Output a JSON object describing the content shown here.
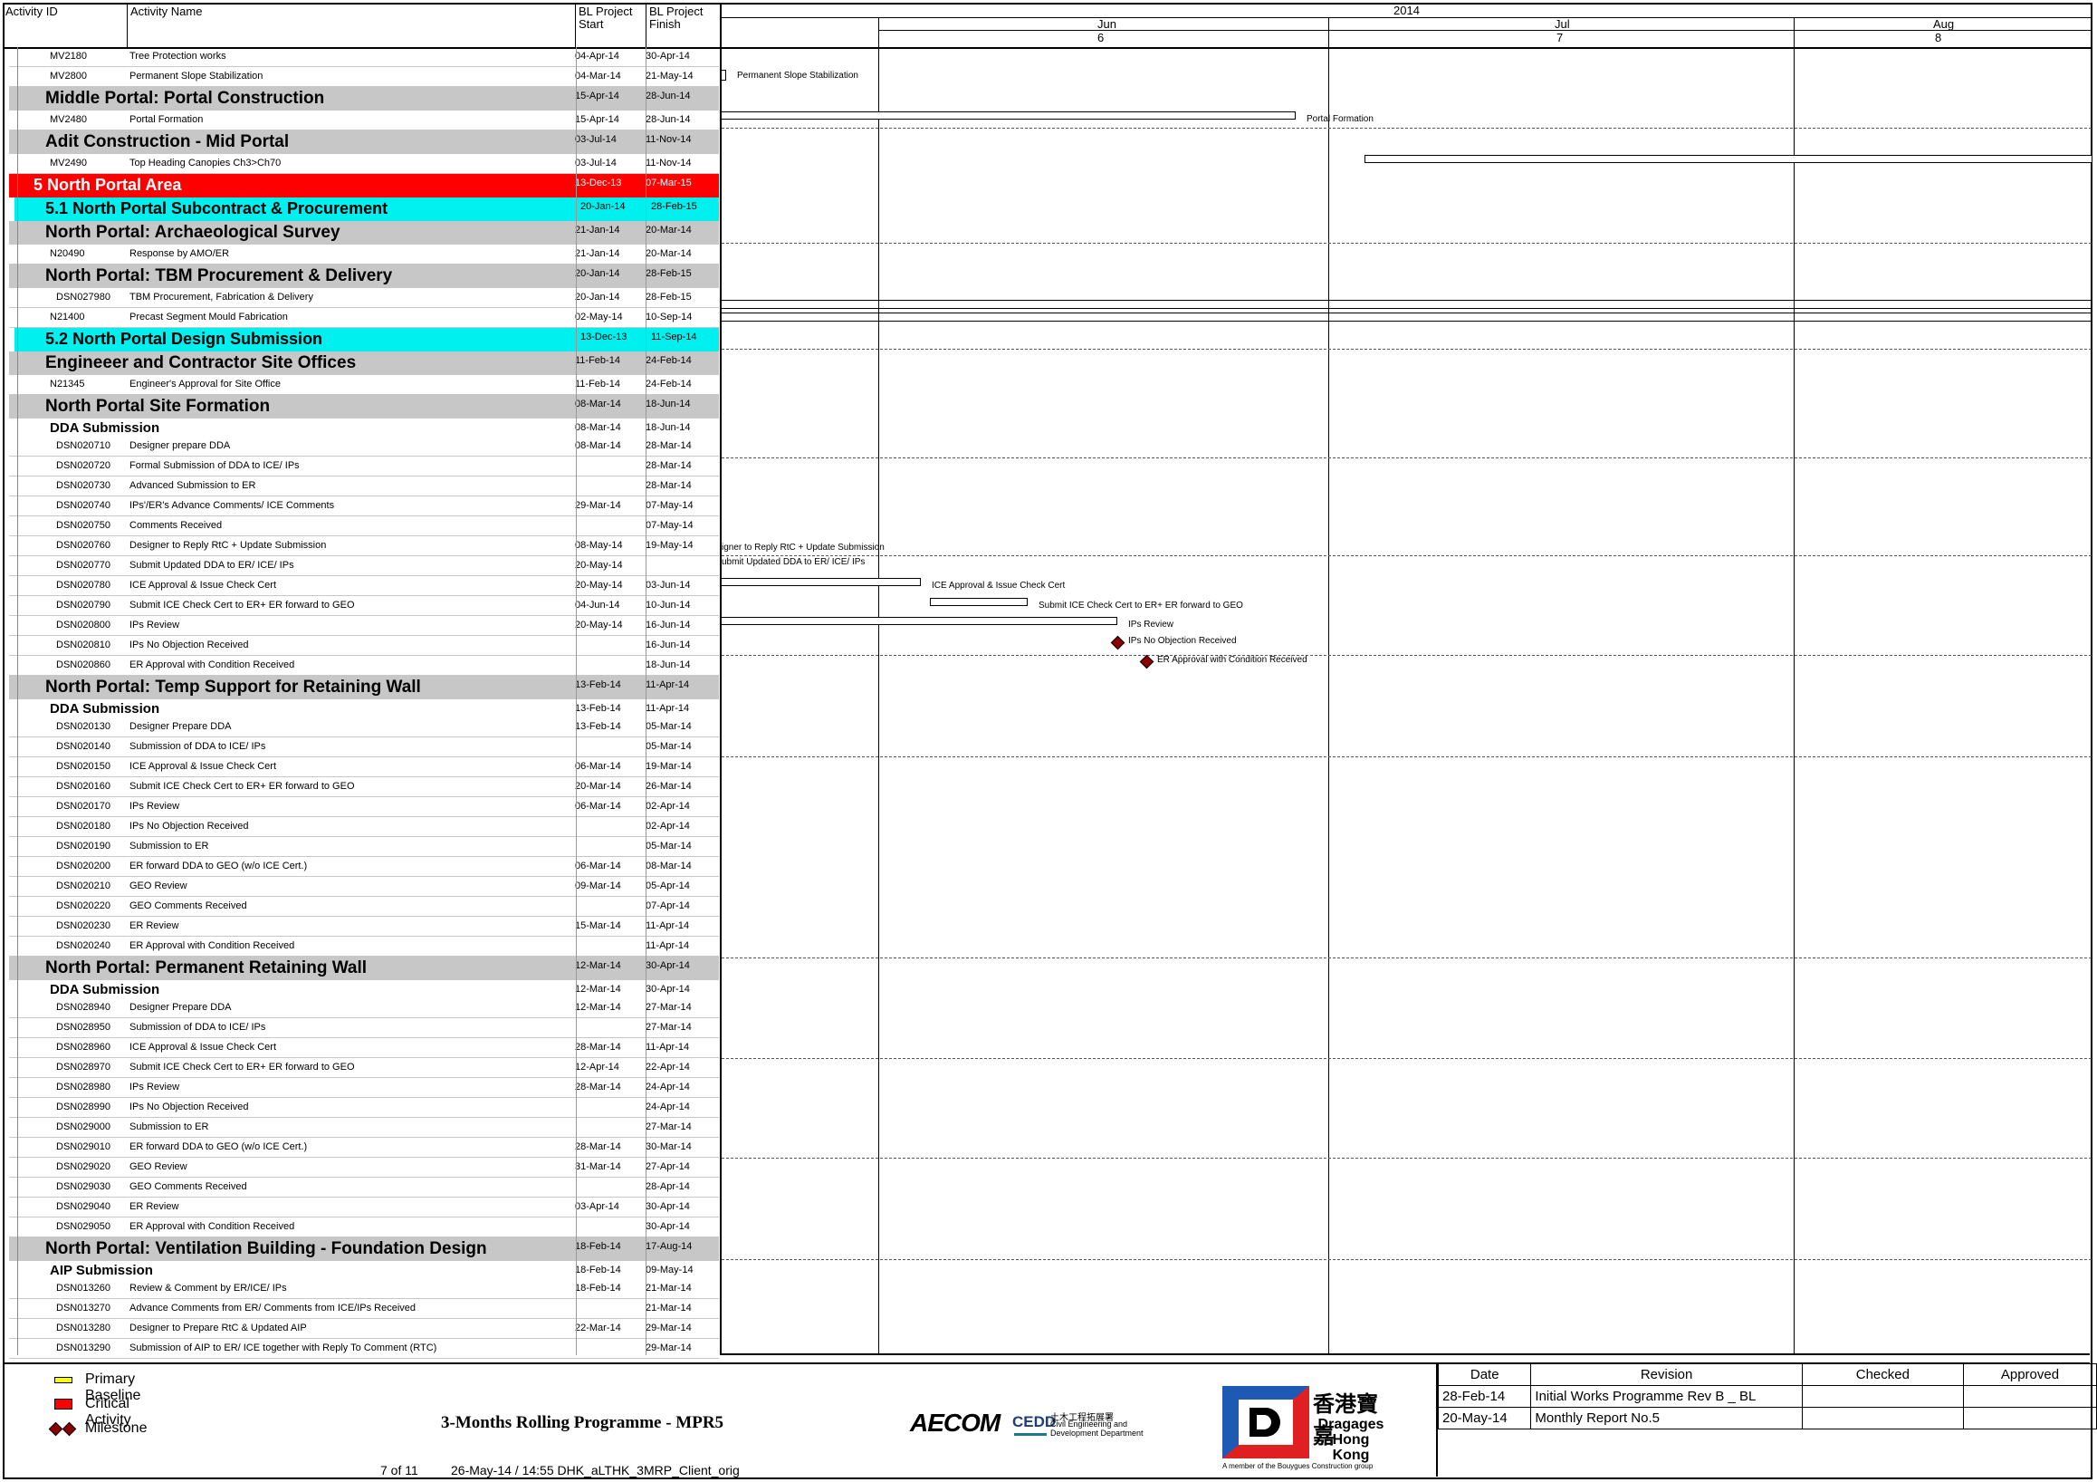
{
  "columns": {
    "activity_id": "Activity ID",
    "activity_name": "Activity Name",
    "start": "BL Project Start",
    "finish": "BL Project Finish"
  },
  "timescale": {
    "year": "2014",
    "months": [
      {
        "name": "Jun",
        "num": "6"
      },
      {
        "name": "Jul",
        "num": "7"
      },
      {
        "name": "Aug",
        "num": "8"
      }
    ]
  },
  "rows": [
    {
      "type": "activity",
      "id": "MV2180",
      "name": "Tree Protection works",
      "start": "04-Apr-14",
      "finish": "30-Apr-14"
    },
    {
      "type": "activity",
      "id": "MV2800",
      "name": "Permanent Slope Stabilization",
      "start": "04-Mar-14",
      "finish": "21-May-14"
    },
    {
      "type": "wbs",
      "title": "Middle Portal: Portal Construction",
      "start": "15-Apr-14",
      "finish": "28-Jun-14"
    },
    {
      "type": "activity",
      "id": "MV2480",
      "name": "Portal Formation",
      "start": "15-Apr-14",
      "finish": "28-Jun-14"
    },
    {
      "type": "wbs",
      "title": "Adit Construction - Mid Portal",
      "start": "03-Jul-14",
      "finish": "11-Nov-14"
    },
    {
      "type": "activity",
      "id": "MV2490",
      "name": "Top Heading Canopies Ch3>Ch70",
      "start": "03-Jul-14",
      "finish": "11-Nov-14"
    },
    {
      "type": "red",
      "title": "5 North Portal Area",
      "start": "13-Dec-13",
      "finish": "07-Mar-15"
    },
    {
      "type": "cyan",
      "title": "5.1 North Portal Subcontract & Procurement",
      "start": "20-Jan-14",
      "finish": "28-Feb-15"
    },
    {
      "type": "wbs",
      "title": "North Portal: Archaeological Survey",
      "start": "21-Jan-14",
      "finish": "20-Mar-14"
    },
    {
      "type": "activity",
      "id": "N20490",
      "name": "Response by AMO/ER",
      "start": "21-Jan-14",
      "finish": "20-Mar-14"
    },
    {
      "type": "wbs",
      "title": "North Portal: TBM Procurement & Delivery",
      "start": "20-Jan-14",
      "finish": "28-Feb-15"
    },
    {
      "type": "activity",
      "id": "DSN027980",
      "name": "TBM Procurement, Fabrication & Delivery",
      "start": "20-Jan-14",
      "finish": "28-Feb-15"
    },
    {
      "type": "activity",
      "id": "N21400",
      "name": "Precast Segment Mould Fabrication",
      "start": "02-May-14",
      "finish": "10-Sep-14"
    },
    {
      "type": "cyan",
      "title": "5.2 North Portal Design Submission",
      "start": "13-Dec-13",
      "finish": "11-Sep-14"
    },
    {
      "type": "wbs",
      "title": "Engineeer and Contractor Site Offices",
      "start": "11-Feb-14",
      "finish": "24-Feb-14"
    },
    {
      "type": "activity",
      "id": "N21345",
      "name": "Engineer's Approval for Site Office",
      "start": "11-Feb-14",
      "finish": "24-Feb-14"
    },
    {
      "type": "wbs",
      "title": "North Portal Site Formation",
      "start": "08-Mar-14",
      "finish": "18-Jun-14"
    },
    {
      "type": "sub",
      "title": "DDA Submission",
      "start": "08-Mar-14",
      "finish": "18-Jun-14"
    },
    {
      "type": "activity",
      "id": "DSN020710",
      "name": "Designer prepare DDA",
      "start": "08-Mar-14",
      "finish": "28-Mar-14"
    },
    {
      "type": "activity",
      "id": "DSN020720",
      "name": "Formal Submission of DDA to ICE/ IPs",
      "start": "",
      "finish": "28-Mar-14"
    },
    {
      "type": "activity",
      "id": "DSN020730",
      "name": "Advanced Submission to ER",
      "start": "",
      "finish": "28-Mar-14"
    },
    {
      "type": "activity",
      "id": "DSN020740",
      "name": "IPs'/ER's Advance Comments/ ICE Comments",
      "start": "29-Mar-14",
      "finish": "07-May-14"
    },
    {
      "type": "activity",
      "id": "DSN020750",
      "name": "Comments Received",
      "start": "",
      "finish": "07-May-14"
    },
    {
      "type": "activity",
      "id": "DSN020760",
      "name": "Designer to Reply RtC + Update Submission",
      "start": "08-May-14",
      "finish": "19-May-14"
    },
    {
      "type": "activity",
      "id": "DSN020770",
      "name": "Submit Updated DDA to ER/ ICE/ IPs",
      "start": "20-May-14",
      "finish": ""
    },
    {
      "type": "activity",
      "id": "DSN020780",
      "name": "ICE Approval & Issue Check Cert",
      "start": "20-May-14",
      "finish": "03-Jun-14"
    },
    {
      "type": "activity",
      "id": "DSN020790",
      "name": "Submit ICE Check Cert to ER+ ER forward to GEO",
      "start": "04-Jun-14",
      "finish": "10-Jun-14"
    },
    {
      "type": "activity",
      "id": "DSN020800",
      "name": "IPs Review",
      "start": "20-May-14",
      "finish": "16-Jun-14"
    },
    {
      "type": "activity",
      "id": "DSN020810",
      "name": "IPs No Objection Received",
      "start": "",
      "finish": "16-Jun-14"
    },
    {
      "type": "activity",
      "id": "DSN020860",
      "name": "ER Approval with Condition Received",
      "start": "",
      "finish": "18-Jun-14"
    },
    {
      "type": "wbs",
      "title": "North Portal: Temp Support for Retaining Wall",
      "start": "13-Feb-14",
      "finish": "11-Apr-14"
    },
    {
      "type": "sub",
      "title": "DDA Submission",
      "start": "13-Feb-14",
      "finish": "11-Apr-14"
    },
    {
      "type": "activity",
      "id": "DSN020130",
      "name": "Designer Prepare DDA",
      "start": "13-Feb-14",
      "finish": "05-Mar-14"
    },
    {
      "type": "activity",
      "id": "DSN020140",
      "name": "Submission of DDA to ICE/ IPs",
      "start": "",
      "finish": "05-Mar-14"
    },
    {
      "type": "activity",
      "id": "DSN020150",
      "name": "ICE Approval & Issue Check Cert",
      "start": "06-Mar-14",
      "finish": "19-Mar-14"
    },
    {
      "type": "activity",
      "id": "DSN020160",
      "name": "Submit ICE Check Cert to ER+ ER forward to GEO",
      "start": "20-Mar-14",
      "finish": "26-Mar-14"
    },
    {
      "type": "activity",
      "id": "DSN020170",
      "name": "IPs Review",
      "start": "06-Mar-14",
      "finish": "02-Apr-14"
    },
    {
      "type": "activity",
      "id": "DSN020180",
      "name": "IPs No Objection Received",
      "start": "",
      "finish": "02-Apr-14"
    },
    {
      "type": "activity",
      "id": "DSN020190",
      "name": "Submission to ER",
      "start": "",
      "finish": "05-Mar-14"
    },
    {
      "type": "activity",
      "id": "DSN020200",
      "name": "ER forward DDA to GEO (w/o ICE Cert.)",
      "start": "06-Mar-14",
      "finish": "08-Mar-14"
    },
    {
      "type": "activity",
      "id": "DSN020210",
      "name": "GEO Review",
      "start": "09-Mar-14",
      "finish": "05-Apr-14"
    },
    {
      "type": "activity",
      "id": "DSN020220",
      "name": "GEO Comments Received",
      "start": "",
      "finish": "07-Apr-14"
    },
    {
      "type": "activity",
      "id": "DSN020230",
      "name": "ER Review",
      "start": "15-Mar-14",
      "finish": "11-Apr-14"
    },
    {
      "type": "activity",
      "id": "DSN020240",
      "name": "ER Approval with Condition Received",
      "start": "",
      "finish": "11-Apr-14"
    },
    {
      "type": "wbs",
      "title": "North Portal: Permanent Retaining Wall",
      "start": "12-Mar-14",
      "finish": "30-Apr-14"
    },
    {
      "type": "sub",
      "title": "DDA Submission",
      "start": "12-Mar-14",
      "finish": "30-Apr-14"
    },
    {
      "type": "activity",
      "id": "DSN028940",
      "name": "Designer Prepare DDA",
      "start": "12-Mar-14",
      "finish": "27-Mar-14"
    },
    {
      "type": "activity",
      "id": "DSN028950",
      "name": "Submission of DDA to ICE/ IPs",
      "start": "",
      "finish": "27-Mar-14"
    },
    {
      "type": "activity",
      "id": "DSN028960",
      "name": "ICE Approval & Issue Check Cert",
      "start": "28-Mar-14",
      "finish": "11-Apr-14"
    },
    {
      "type": "activity",
      "id": "DSN028970",
      "name": "Submit ICE Check Cert to ER+ ER forward to GEO",
      "start": "12-Apr-14",
      "finish": "22-Apr-14"
    },
    {
      "type": "activity",
      "id": "DSN028980",
      "name": "IPs Review",
      "start": "28-Mar-14",
      "finish": "24-Apr-14"
    },
    {
      "type": "activity",
      "id": "DSN028990",
      "name": "IPs No Objection Received",
      "start": "",
      "finish": "24-Apr-14"
    },
    {
      "type": "activity",
      "id": "DSN029000",
      "name": "Submission to ER",
      "start": "",
      "finish": "27-Mar-14"
    },
    {
      "type": "activity",
      "id": "DSN029010",
      "name": "ER forward DDA to GEO (w/o ICE Cert.)",
      "start": "28-Mar-14",
      "finish": "30-Mar-14"
    },
    {
      "type": "activity",
      "id": "DSN029020",
      "name": "GEO Review",
      "start": "31-Mar-14",
      "finish": "27-Apr-14"
    },
    {
      "type": "activity",
      "id": "DSN029030",
      "name": "GEO Comments Received",
      "start": "",
      "finish": "28-Apr-14"
    },
    {
      "type": "activity",
      "id": "DSN029040",
      "name": "ER Review",
      "start": "03-Apr-14",
      "finish": "30-Apr-14"
    },
    {
      "type": "activity",
      "id": "DSN029050",
      "name": "ER Approval with Condition Received",
      "start": "",
      "finish": "30-Apr-14"
    },
    {
      "type": "wbs",
      "title": "North Portal: Ventilation Building - Foundation Design",
      "start": "18-Feb-14",
      "finish": "17-Aug-14"
    },
    {
      "type": "sub",
      "title": "AIP Submission",
      "start": "18-Feb-14",
      "finish": "09-May-14"
    },
    {
      "type": "activity",
      "id": "DSN013260",
      "name": "Review & Comment by ER/ICE/ IPs",
      "start": "18-Feb-14",
      "finish": "21-Mar-14"
    },
    {
      "type": "activity",
      "id": "DSN013270",
      "name": "Advance Comments from ER/ Comments from ICE/IPs Received",
      "start": "",
      "finish": "21-Mar-14"
    },
    {
      "type": "activity",
      "id": "DSN013280",
      "name": "Designer to Prepare RtC & Updated AIP",
      "start": "22-Mar-14",
      "finish": "29-Mar-14"
    },
    {
      "type": "activity",
      "id": "DSN013290",
      "name": "Submission of AIP to ER/ ICE together with Reply To Comment (RTC)",
      "start": "",
      "finish": "29-Mar-14"
    }
  ],
  "gantt_labels": {
    "permanent_slope": "Permanent Slope Stabilization",
    "portal_formation": "Portal Formation",
    "designer_reply": "igner to Reply RtC + Update Submission",
    "submit_updated": "ubmit Updated DDA to ER/ ICE/ IPs",
    "ice_approval": "ICE Approval & Issue Check Cert",
    "submit_ice": "Submit ICE Check Cert to ER+ ER forward to GEO",
    "ips_review": "IPs Review",
    "ips_no_objection": "IPs No Objection Received",
    "er_approval": "ER Approval with Condition Received"
  },
  "legend": {
    "baseline": "Primary Baseline",
    "critical": "Critical Activity",
    "milestone": "Milestone",
    "baseline_color": "#ffff00",
    "critical_color": "#ff0000",
    "milestone_color": "#8b0000"
  },
  "footer": {
    "programme_title": "3-Months Rolling Programme - MPR5",
    "page": "7 of 11",
    "print_info": "26-May-14 / 14:55 DHK_aLTHK_3MRP_Client_orig",
    "aecom": "AECOM",
    "cedd_short": "CEDD",
    "cedd_chinese": "土木工程拓展署",
    "cedd_english": "Civil Engineering and Development Department",
    "dragages_chinese": "香港寶嘉",
    "dragages_name": "Dragages Hong Kong",
    "dragages_tag": "A member of the Bouygues Construction group"
  },
  "revisions": {
    "headers": [
      "Date",
      "Revision",
      "Checked",
      "Approved"
    ],
    "rows": [
      {
        "date": "28-Feb-14",
        "revision": "Initial Works Programme Rev B _ BL",
        "checked": "",
        "approved": ""
      },
      {
        "date": "20-May-14",
        "revision": "Monthly Report No.5",
        "checked": "",
        "approved": ""
      }
    ]
  }
}
